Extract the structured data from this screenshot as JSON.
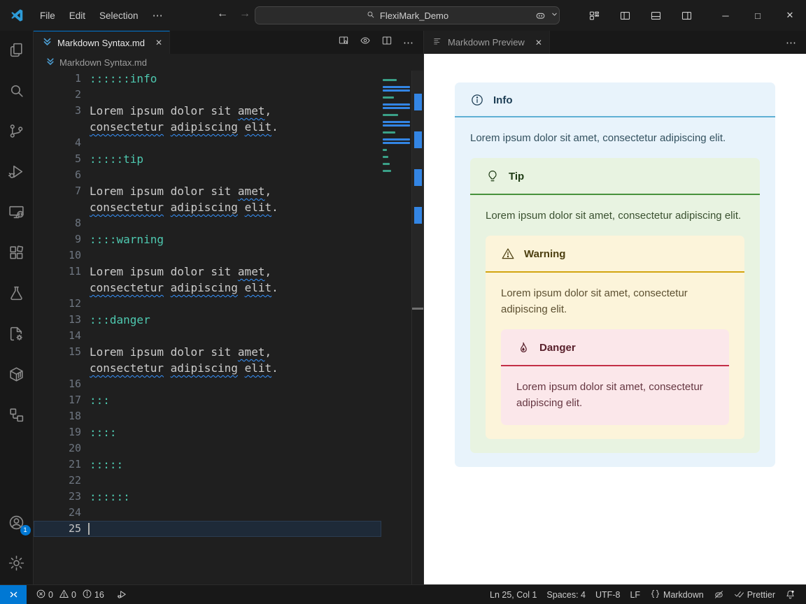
{
  "glyphs": {
    "close": "✕",
    "more": "⋯",
    "back": "←",
    "forward": "→",
    "minimize": "─",
    "maximize": "□"
  },
  "titlebar": {
    "menus": [
      "File",
      "Edit",
      "Selection"
    ],
    "search_value": "FlexiMark_Demo"
  },
  "editor_group": {
    "tab_title": "Markdown Syntax.md",
    "breadcrumb": "Markdown Syntax.md"
  },
  "preview_group": {
    "tab_title": "Markdown Preview"
  },
  "editor": {
    "colors": {
      "directive": "#4ec9b0",
      "text": "#cccccc",
      "squiggle": "#3794ff",
      "minimap_directive": "#3aa087",
      "minimap_text_bar": "#3385e4"
    },
    "lorem_row1": [
      [
        "Lorem ipsum dolor sit ",
        "t"
      ],
      [
        "amet",
        "s"
      ],
      [
        ",",
        "t"
      ]
    ],
    "lorem_row2": [
      [
        "consectetur",
        "s"
      ],
      [
        " ",
        "t"
      ],
      [
        "adipiscing",
        "s"
      ],
      [
        " ",
        "t"
      ],
      [
        "elit",
        "s"
      ],
      [
        ".",
        "t"
      ]
    ],
    "lines": [
      {
        "n": 1,
        "d": "::::::info"
      },
      {
        "n": 2
      },
      {
        "n": 3,
        "lorem": true
      },
      {
        "n": 4
      },
      {
        "n": 5,
        "d": ":::::tip"
      },
      {
        "n": 6
      },
      {
        "n": 7,
        "lorem": true
      },
      {
        "n": 8
      },
      {
        "n": 9,
        "d": "::::warning"
      },
      {
        "n": 10
      },
      {
        "n": 11,
        "lorem": true
      },
      {
        "n": 12
      },
      {
        "n": 13,
        "d": ":::danger"
      },
      {
        "n": 14
      },
      {
        "n": 15,
        "lorem": true
      },
      {
        "n": 16
      },
      {
        "n": 17,
        "d": ":::"
      },
      {
        "n": 18
      },
      {
        "n": 19,
        "d": "::::"
      },
      {
        "n": 20
      },
      {
        "n": 21,
        "d": ":::::"
      },
      {
        "n": 22
      },
      {
        "n": 23,
        "d": "::::::"
      },
      {
        "n": 24
      },
      {
        "n": 25,
        "cursor": true
      }
    ]
  },
  "preview": {
    "admonition": {
      "type": "info",
      "title": "Info",
      "icon": "info-icon",
      "text": "Lorem ipsum dolor sit amet, consectetur adipiscing elit.",
      "colors": {
        "bg": "#e8f3fb",
        "line": "#5fb0d4",
        "title": "#1c3d54",
        "body": "#33515f"
      },
      "child": {
        "type": "tip",
        "title": "Tip",
        "icon": "lightbulb-icon",
        "text": "Lorem ipsum dolor sit amet, consectetur adipiscing elit.",
        "colors": {
          "bg": "#e8f3e1",
          "line": "#48923c",
          "title": "#1e3b14",
          "body": "#3a5130"
        },
        "child": {
          "type": "warning",
          "title": "Warning",
          "icon": "warning-icon",
          "text": "Lorem ipsum dolor sit amet, consectetur adipiscing elit.",
          "colors": {
            "bg": "#fcf4da",
            "line": "#d2a511",
            "title": "#4c3f10",
            "body": "#5d5031"
          },
          "child": {
            "type": "danger",
            "title": "Danger",
            "icon": "flame-icon",
            "text": "Lorem ipsum dolor sit amet, consectetur adipiscing elit.",
            "colors": {
              "bg": "#fbe7ea",
              "line": "#c42f47",
              "title": "#58202b",
              "body": "#653641"
            },
            "child": null
          }
        }
      }
    }
  },
  "activity_bar": {
    "items": [
      {
        "icon": "files-icon"
      },
      {
        "icon": "search-icon"
      },
      {
        "icon": "source-control-icon"
      },
      {
        "icon": "run-debug-icon"
      },
      {
        "icon": "remote-explorer-icon"
      },
      {
        "icon": "extensions-icon"
      },
      {
        "icon": "testing-icon"
      },
      {
        "icon": "file-gear-icon"
      },
      {
        "icon": "container-icon"
      },
      {
        "icon": "flowchart-icon"
      }
    ],
    "account_badge": "1"
  },
  "statusbar": {
    "errors": "0",
    "warnings": "0",
    "infos": "16",
    "line_col": "Ln 25, Col 1",
    "spaces": "Spaces: 4",
    "encoding": "UTF-8",
    "eol": "LF",
    "language": "Markdown",
    "formatter": "Prettier"
  },
  "colors": {
    "accent": "#0078d4"
  }
}
